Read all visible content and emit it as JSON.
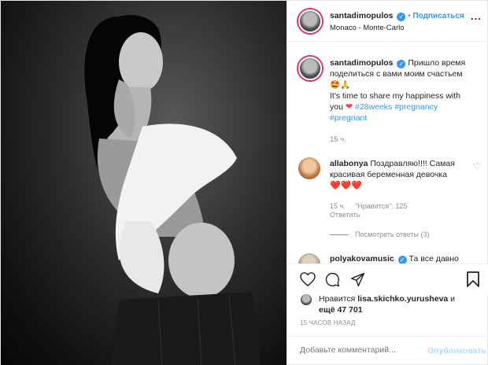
{
  "header": {
    "username": "santadimopulos",
    "follow_label": "Подписаться",
    "separator": "•",
    "location": "Monaco - Monte-Carlo",
    "more": "..."
  },
  "caption": {
    "username": "santadimopulos",
    "line1": "Пришло время",
    "line2": "поделиться с вами моим счастьем",
    "emoji": "🤩🙏",
    "line3": "It's time to share my happiness with",
    "line4": "you",
    "tag1": "#28weeks",
    "tag2": "#pregnancy",
    "tag3": "#pregnant",
    "time": "15 ч."
  },
  "comment1": {
    "username": "allabonya",
    "line1": "Поздравляю!!!! Самая",
    "line2": "красивая беременная девочка",
    "hearts": "❤️❤️❤️",
    "time": "15 ч.",
    "likes": "\"Нравится\": 125",
    "reply": "Ответить",
    "view_replies": "Посмотреть ответы (3)"
  },
  "comment2": {
    "username": "polyakovamusic",
    "text": "Та все давно"
  },
  "likes": {
    "prefix": "Нравится",
    "user": "lisa.skichko.yurusheva",
    "suffix": "и",
    "count": "ещё 47 701"
  },
  "timestamp": "15 ЧАСОВ НАЗАД",
  "add_comment": {
    "placeholder": "Добавьте комментарий...",
    "publish": "Опубликовать"
  }
}
